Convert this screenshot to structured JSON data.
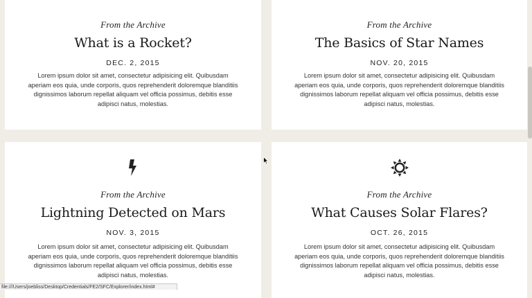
{
  "cards": [
    {
      "icon": "rocket-icon",
      "kicker": "From the Archive",
      "title": "What is a Rocket?",
      "date": "DEC. 2, 2015",
      "body": "Lorem ipsum dolor sit amet, consectetur adipisicing elit. Quibusdam aperiam eos quia, unde corporis, quos reprehenderit doloremque blanditiis dignissimos laborum repellat aliquam vel officia possimus, debitis esse adipisci natus, molestias."
    },
    {
      "icon": "star-badge-icon",
      "kicker": "From the Archive",
      "title": "The Basics of Star Names",
      "date": "NOV. 20, 2015",
      "body": "Lorem ipsum dolor sit amet, consectetur adipisicing elit. Quibusdam aperiam eos quia, unde corporis, quos reprehenderit doloremque blanditiis dignissimos laborum repellat aliquam vel officia possimus, debitis esse adipisci natus, molestias."
    },
    {
      "icon": "lightning-bolt-icon",
      "kicker": "From the Archive",
      "title": "Lightning Detected on Mars",
      "date": "NOV. 3, 2015",
      "body": "Lorem ipsum dolor sit amet, consectetur adipisicing elit. Quibusdam aperiam eos quia, unde corporis, quos reprehenderit doloremque blanditiis dignissimos laborum repellat aliquam vel officia possimus, debitis esse adipisci natus, molestias."
    },
    {
      "icon": "sun-icon",
      "kicker": "From the Archive",
      "title": "What Causes Solar Flares?",
      "date": "OCT. 26, 2015",
      "body": "Lorem ipsum dolor sit amet, consectetur adipisicing elit. Quibusdam aperiam eos quia, unde corporis, quos reprehenderit doloremque blanditiis dignissimos laborum repellat aliquam vel officia possimus, debitis esse adipisci natus, molestias."
    }
  ],
  "status_bar": {
    "url": "file:///Users/joebliss/Desktop/Credentials/FE2/SFC/Explorer/index.html#"
  },
  "colors": {
    "page_background": "#efede6",
    "card_background": "#ffffff",
    "text": "#222222"
  }
}
